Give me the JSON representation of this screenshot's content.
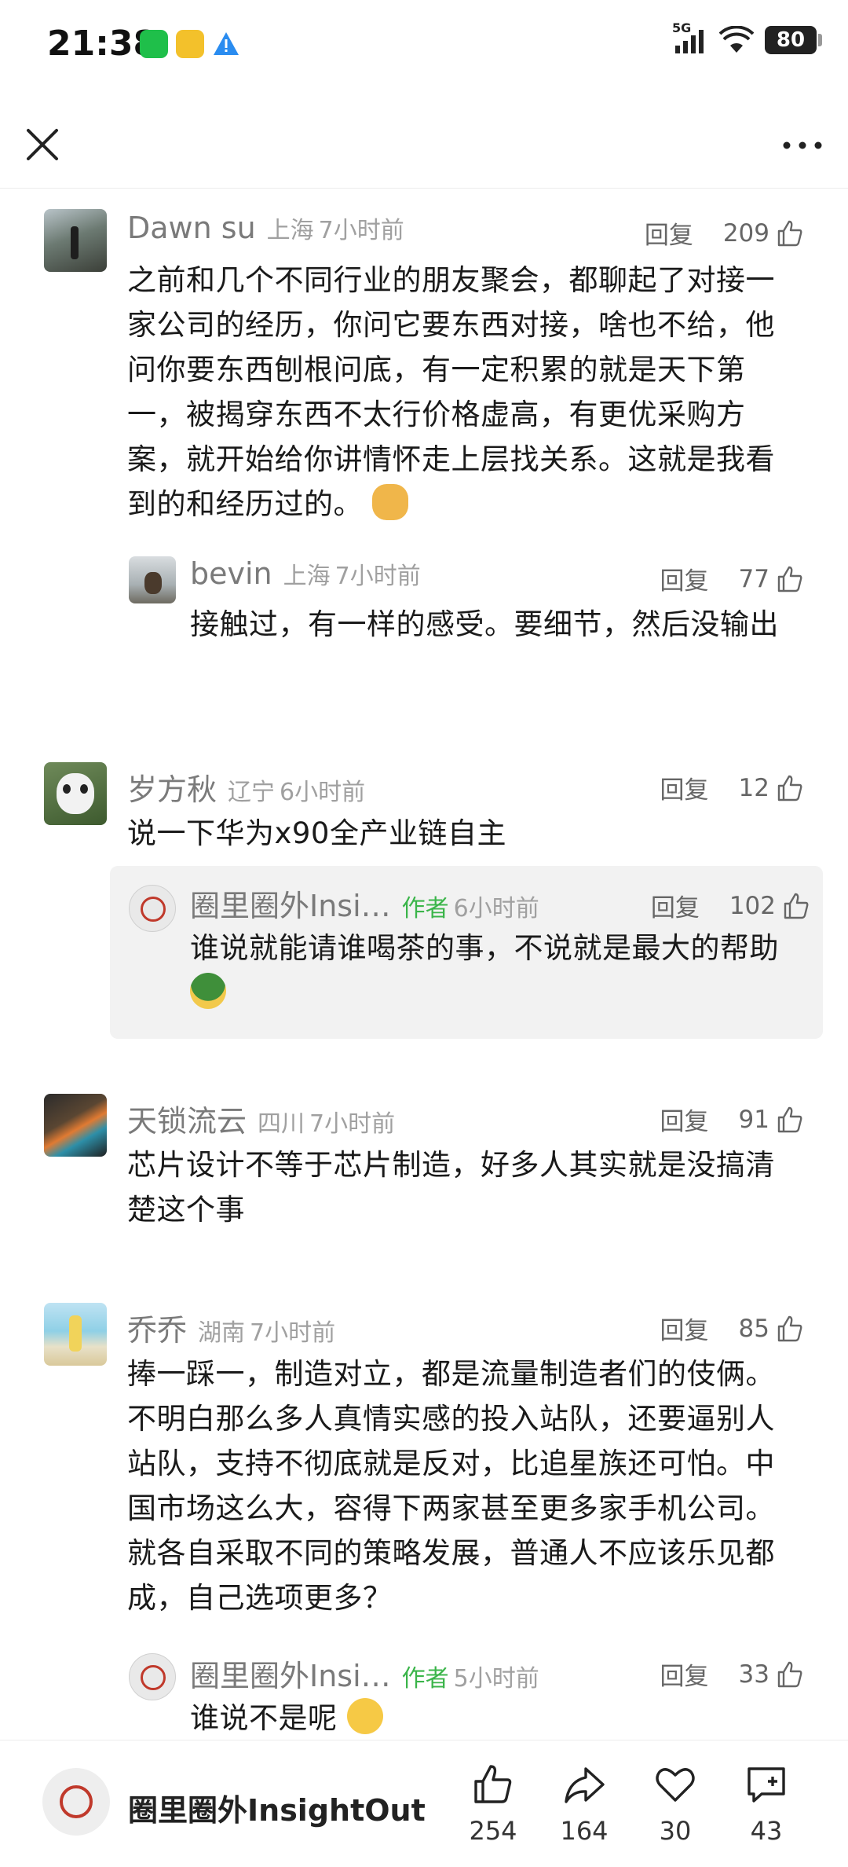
{
  "status_bar": {
    "time": "21:38",
    "network": "5G",
    "battery": "80"
  },
  "nav": {
    "close_icon": "close-icon",
    "more_icon": "more-icon"
  },
  "comments": [
    {
      "name": "Dawn su",
      "location": "上海",
      "time": "7小时前",
      "reply": "回复",
      "likes": "209",
      "text": "之前和几个不同行业的朋友聚会，都聊起了对接一家公司的经历，你问它要东西对接，啥也不给，他问你要东西刨根问底，有一定积累的就是天下第一，被揭穿东西不太行价格虚高，有更优采购方案，就开始给你讲情怀走上层找关系。这就是我看到的和经历过的。"
    },
    {
      "name": "bevin",
      "location": "上海",
      "time": "7小时前",
      "reply": "回复",
      "likes": "77",
      "text": "接触过，有一样的感受。要细节，然后没输出"
    },
    {
      "name": "岁方秋",
      "location": "辽宁",
      "time": "6小时前",
      "reply": "回复",
      "likes": "12",
      "text": "说一下华为x90全产业链自主"
    },
    {
      "name": "圈里圈外Insi…",
      "author_tag": "作者",
      "time": "6小时前",
      "reply": "回复",
      "likes": "102",
      "text": "谁说就能请谁喝茶的事，不说就是最大的帮助"
    },
    {
      "name": "天锁流云",
      "location": "四川",
      "time": "7小时前",
      "reply": "回复",
      "likes": "91",
      "text": "芯片设计不等于芯片制造，好多人其实就是没搞清楚这个事"
    },
    {
      "name": "乔乔",
      "location": "湖南",
      "time": "7小时前",
      "reply": "回复",
      "likes": "85",
      "text": "捧一踩一，制造对立，都是流量制造者们的伎俩。不明白那么多人真情实感的投入站队，还要逼别人站队，支持不彻底就是反对，比追星族还可怕。中国市场这么大，容得下两家甚至更多家手机公司。就各自采取不同的策略发展，普通人不应该乐见都成，自己选项更多？"
    },
    {
      "name": "圈里圈外Insi…",
      "author_tag": "作者",
      "time": "5小时前",
      "reply": "回复",
      "likes": "33",
      "text": "谁说不是呢"
    }
  ],
  "bottom_bar": {
    "account_name": "圈里圈外InsightOut",
    "like_count": "254",
    "share_count": "164",
    "favorite_count": "30",
    "comment_count": "43"
  }
}
